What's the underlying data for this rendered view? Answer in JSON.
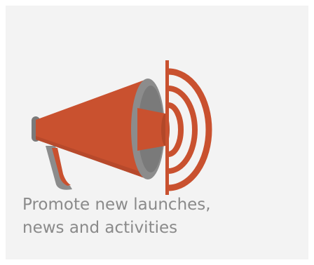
{
  "card": {
    "icon": "megaphone-icon",
    "caption_lines": [
      "Promote new launches,",
      "news and activities"
    ]
  },
  "colors": {
    "background": "#f3f3f3",
    "accent": "#c9512f",
    "accent_dark": "#9e3a1f",
    "gray": "#8c8c8c",
    "gray_dark": "#6f6f6f",
    "text": "#8a8a8a"
  }
}
